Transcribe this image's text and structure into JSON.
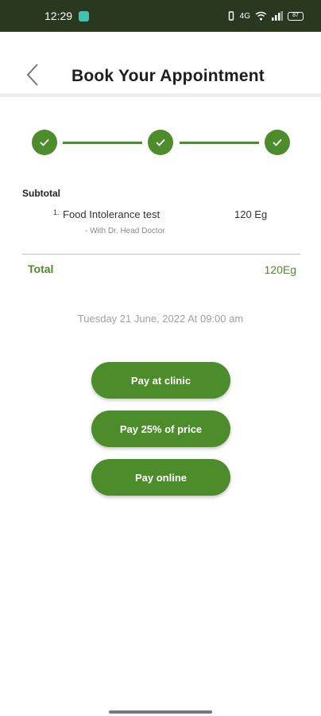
{
  "status_bar": {
    "time": "12:29",
    "network": "4G",
    "battery": "87"
  },
  "header": {
    "title": "Book Your Appointment"
  },
  "summary": {
    "subtotal_label": "Subtotal",
    "items": [
      {
        "number": "1.",
        "name": "Food Intolerance test",
        "price": "120 Eg",
        "doctor": "- With Dr. Head Doctor"
      }
    ],
    "total_label": "Total",
    "total_value": "120Eg",
    "appointment_date": "Tuesday 21 June, 2022 At 09:00 am"
  },
  "payment_options": {
    "clinic": "Pay at clinic",
    "partial": "Pay 25% of price",
    "online": "Pay online"
  },
  "colors": {
    "accent": "#4d8c2a",
    "status_bar": "#29381f"
  }
}
